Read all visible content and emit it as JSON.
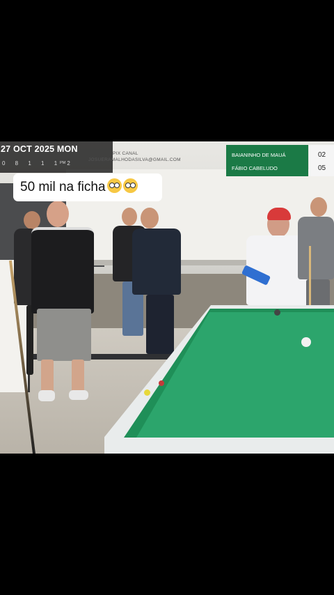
{
  "overlay": {
    "date_text": "27 OCT 2025 MON",
    "time_text": "0 8 1 1 1 2",
    "time_suffix": "PM",
    "pix_label": "PIX CANAL",
    "pix_email": "JOSUERAMALHODASILVA@GMAIL.COM"
  },
  "scoreboard": {
    "players": [
      {
        "name": "BAIANINHO DE MAUÁ",
        "score": "02"
      },
      {
        "name": "FÁBIO CABELUDO",
        "score": "05"
      }
    ],
    "accent_color": "#1b7a46"
  },
  "caption": {
    "text": "50 mil na ficha",
    "emojis": [
      "scream-emoji",
      "scream-emoji"
    ]
  }
}
